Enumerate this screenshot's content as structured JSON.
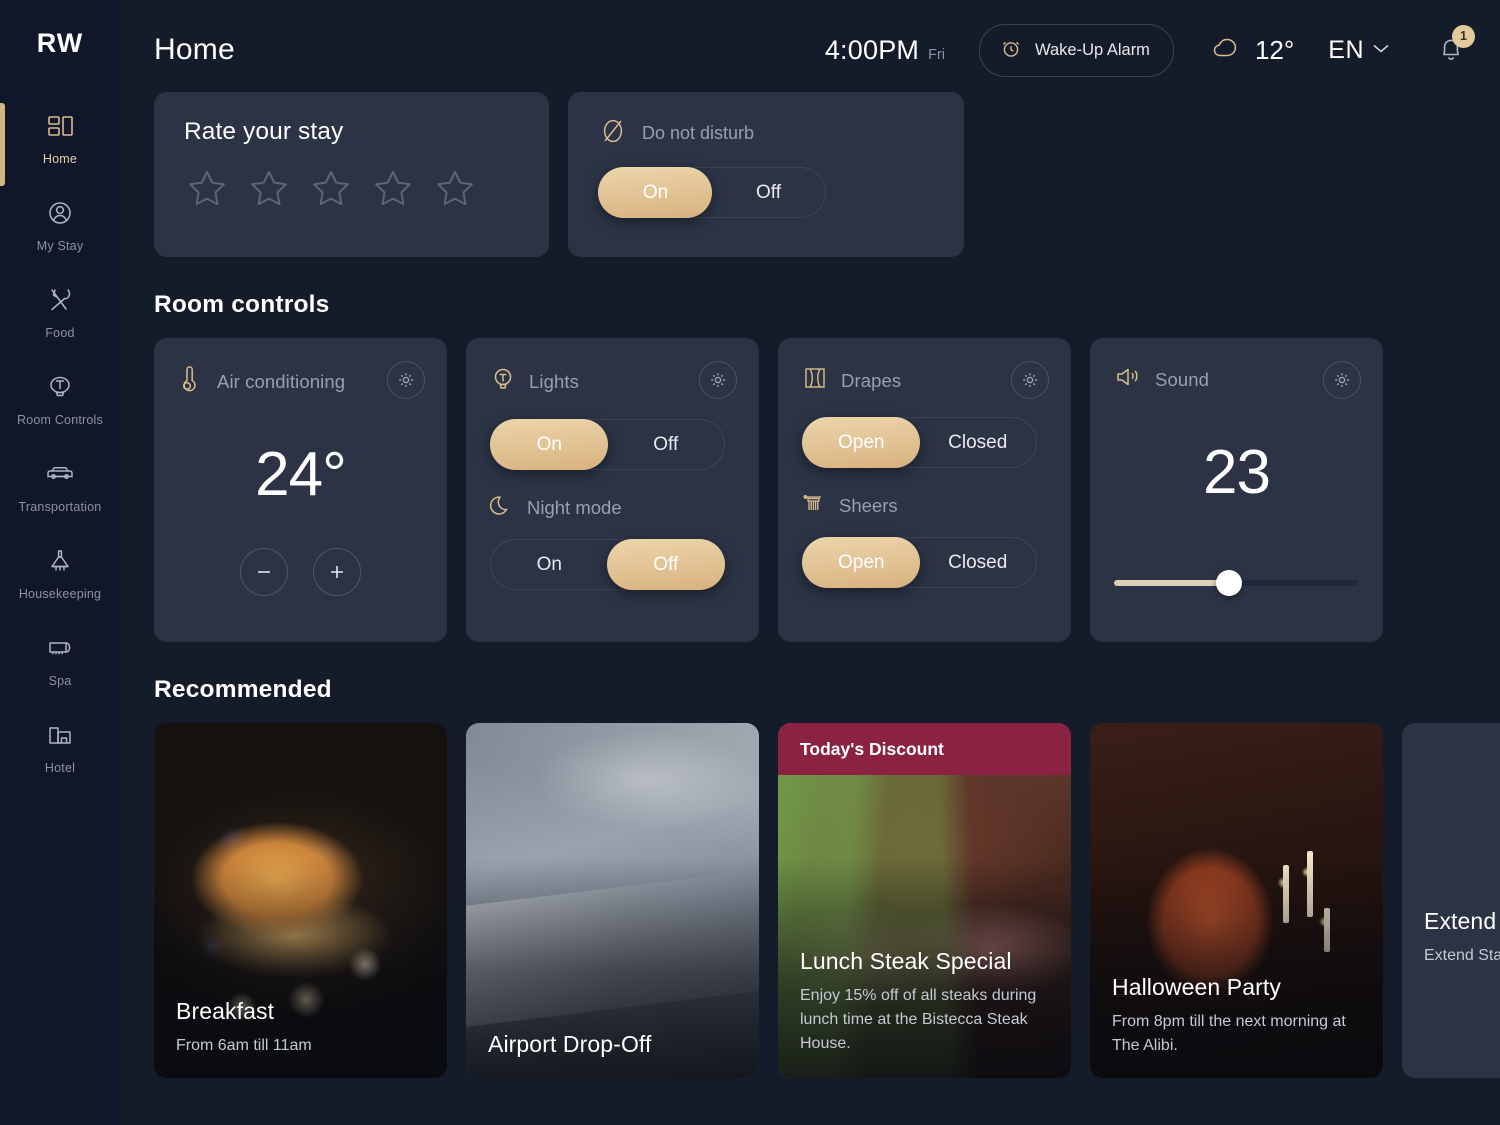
{
  "sidebar": {
    "logo": "RW",
    "items": [
      {
        "label": "Home",
        "icon": "home-icon",
        "active": true
      },
      {
        "label": "My Stay",
        "icon": "user-icon",
        "active": false
      },
      {
        "label": "Food",
        "icon": "cutlery-icon",
        "active": false
      },
      {
        "label": "Room Controls",
        "icon": "lamp-icon",
        "active": false
      },
      {
        "label": "Transportation",
        "icon": "car-icon",
        "active": false
      },
      {
        "label": "Housekeeping",
        "icon": "broom-icon",
        "active": false
      },
      {
        "label": "Spa",
        "icon": "towel-icon",
        "active": false
      },
      {
        "label": "Hotel",
        "icon": "building-icon",
        "active": false
      }
    ]
  },
  "header": {
    "title": "Home",
    "time": "4:00PM",
    "day": "Fri",
    "alarm_label": "Wake-Up Alarm",
    "alarm_icon": "alarm-clock-icon",
    "weather_icon": "cloud-icon",
    "temperature": "12°",
    "language": "EN",
    "chevron_icon": "chevron-down-icon",
    "bell_icon": "bell-icon",
    "notification_count": "1"
  },
  "rate_card": {
    "title": "Rate your stay",
    "stars_total": 5,
    "stars_filled": 0
  },
  "dnd_card": {
    "icon": "do-not-disturb-icon",
    "label": "Do not disturb",
    "on_label": "On",
    "off_label": "Off",
    "selected": "On"
  },
  "room_controls": {
    "section_title": "Room controls",
    "cards": [
      {
        "name": "air-conditioning",
        "title": "Air conditioning",
        "icon": "thermometer-icon",
        "gear_icon": "gear-icon",
        "value": "24°",
        "decrease_label": "−",
        "increase_label": "+"
      },
      {
        "name": "lights",
        "title": "Lights",
        "icon": "lightbulb-icon",
        "gear_icon": "gear-icon",
        "on_label": "On",
        "off_label": "Off",
        "selected": "On",
        "sub_title": "Night mode",
        "sub_icon": "moon-icon",
        "sub_on_label": "On",
        "sub_off_label": "Off",
        "sub_selected": "Off"
      },
      {
        "name": "drapes",
        "title": "Drapes",
        "icon": "curtain-icon",
        "gear_icon": "gear-icon",
        "open_label": "Open",
        "closed_label": "Closed",
        "selected": "Open",
        "sub_title": "Sheers",
        "sub_icon": "sheers-icon",
        "sub_open_label": "Open",
        "sub_closed_label": "Closed",
        "sub_selected": "Open"
      },
      {
        "name": "sound",
        "title": "Sound",
        "icon": "speaker-icon",
        "gear_icon": "gear-icon",
        "value": "23",
        "slider_percent": 47
      }
    ]
  },
  "recommended": {
    "section_title": "Recommended",
    "cards": [
      {
        "title": "Breakfast",
        "subtitle": "From 6am till 11am",
        "ribbon": ""
      },
      {
        "title": "Airport Drop-Off",
        "subtitle": "",
        "ribbon": ""
      },
      {
        "title": "Lunch Steak Special",
        "subtitle": "Enjoy 15% off of all steaks during lunch time at the Bistecca Steak House.",
        "ribbon": "Today's Discount"
      },
      {
        "title": "Halloween Party",
        "subtitle": "From 8pm till the next morning at The Alibi.",
        "ribbon": ""
      },
      {
        "title": "Extend",
        "subtitle": "Extend Sta",
        "ribbon": ""
      }
    ]
  },
  "colors": {
    "background": "#141b29",
    "sidebar": "#10172a",
    "card": "#2b3345",
    "accent": "#d8b27f",
    "accent_light": "#ecd5ab",
    "ribbon": "#8c2241",
    "muted_text": "#97a0b2"
  }
}
